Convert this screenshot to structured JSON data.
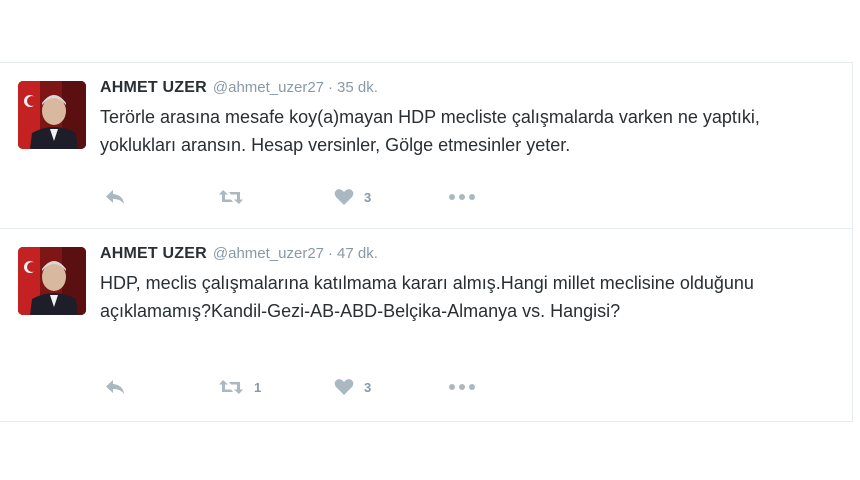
{
  "tweets": [
    {
      "name": "AHMET UZER",
      "handle": "@ahmet_uzer27",
      "separator": "·",
      "time": "35 dk.",
      "text": "Terörle arasına mesafe koy(a)mayan HDP mecliste çalışmalarda varken ne yaptıki, yoklukları aransın. Hesap versinler, Gölge etmesinler yeter.",
      "actions": {
        "reply_icon": "reply-icon",
        "retweet_icon": "retweet-icon",
        "retweet_count": "",
        "like_icon": "heart-icon",
        "like_count": "3",
        "more_icon": "more-dots-icon"
      }
    },
    {
      "name": "AHMET UZER",
      "handle": "@ahmet_uzer27",
      "separator": "·",
      "time": "47 dk.",
      "text": "HDP, meclis çalışmalarına katılmama kararı almış.Hangi millet meclisine olduğunu açıklamamış?Kandil-Gezi-AB-ABD-Belçika-Almanya vs. Hangisi?",
      "actions": {
        "reply_icon": "reply-icon",
        "retweet_icon": "retweet-icon",
        "retweet_count": "1",
        "like_icon": "heart-icon",
        "like_count": "3",
        "more_icon": "more-dots-icon"
      }
    }
  ],
  "colors": {
    "text": "#292f33",
    "meta": "#8899a6",
    "icon": "#aab8c2",
    "divider": "#e6ecf0",
    "avatar_bg": "#8a1a1a"
  }
}
